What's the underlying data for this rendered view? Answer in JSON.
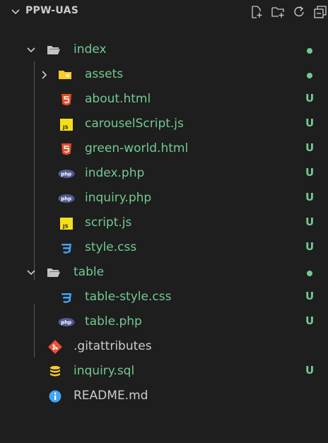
{
  "explorer": {
    "title": "PPW-UAS",
    "actions": [
      "new-file-icon",
      "new-folder-icon",
      "refresh-icon",
      "collapse-all-icon"
    ]
  },
  "tree": [
    {
      "label": "index",
      "type": "folder-open",
      "depth": 1,
      "status": "dot"
    },
    {
      "label": "assets",
      "type": "folder-closed",
      "depth": 2,
      "status": "dot"
    },
    {
      "label": "about.html",
      "type": "html",
      "depth": 2,
      "status": "U"
    },
    {
      "label": "carouselScript.js",
      "type": "js",
      "depth": 2,
      "status": "U"
    },
    {
      "label": "green-world.html",
      "type": "html",
      "depth": 2,
      "status": "U"
    },
    {
      "label": "index.php",
      "type": "php",
      "depth": 2,
      "status": "U"
    },
    {
      "label": "inquiry.php",
      "type": "php",
      "depth": 2,
      "status": "U"
    },
    {
      "label": "script.js",
      "type": "js",
      "depth": 2,
      "status": "U"
    },
    {
      "label": "style.css",
      "type": "css",
      "depth": 2,
      "status": "U"
    },
    {
      "label": "table",
      "type": "folder-open",
      "depth": 1,
      "status": "dot"
    },
    {
      "label": "table-style.css",
      "type": "css",
      "depth": 2,
      "status": "U"
    },
    {
      "label": "table.php",
      "type": "php",
      "depth": 2,
      "status": "U"
    },
    {
      "label": ".gitattributes",
      "type": "git",
      "depth": 1,
      "status": ""
    },
    {
      "label": "inquiry.sql",
      "type": "sql",
      "depth": 1,
      "status": "U"
    },
    {
      "label": "README.md",
      "type": "info",
      "depth": 1,
      "status": ""
    }
  ],
  "icon_labels": {
    "js": "JS",
    "php": "php"
  },
  "colors": {
    "untracked": "#73c991",
    "html": "#e44d26",
    "js": "#f5de19",
    "php": "#4f5b93",
    "css": "#42a5f5",
    "folder": "#c5c5c5",
    "assets_folder": "#ffca28",
    "git": "#f05032",
    "sql": "#ffca28",
    "info": "#42a5f5"
  }
}
